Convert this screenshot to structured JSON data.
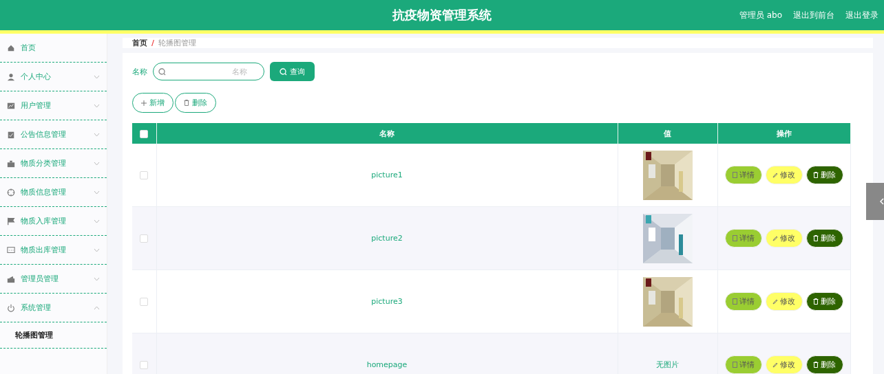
{
  "header": {
    "title": "抗疫物资管理系统",
    "links": [
      "管理员 abo",
      "退出到前台",
      "退出登录"
    ]
  },
  "sidebar": {
    "items": [
      {
        "label": "首页",
        "expandable": false
      },
      {
        "label": "个人中心",
        "expandable": true,
        "expanded": false
      },
      {
        "label": "用户管理",
        "expandable": true,
        "expanded": false
      },
      {
        "label": "公告信息管理",
        "expandable": true,
        "expanded": false
      },
      {
        "label": "物质分类管理",
        "expandable": true,
        "expanded": false
      },
      {
        "label": "物质信息管理",
        "expandable": true,
        "expanded": false
      },
      {
        "label": "物质入库管理",
        "expandable": true,
        "expanded": false
      },
      {
        "label": "物质出库管理",
        "expandable": true,
        "expanded": false
      },
      {
        "label": "管理员管理",
        "expandable": true,
        "expanded": false
      },
      {
        "label": "系统管理",
        "expandable": true,
        "expanded": true,
        "children": [
          {
            "label": "轮播图管理",
            "selected": true
          }
        ]
      }
    ]
  },
  "breadcrumb": {
    "items": [
      "首页",
      "轮播图管理"
    ],
    "separator": "/"
  },
  "search": {
    "label": "名称",
    "placeholder": "名称",
    "button": "查询"
  },
  "toolbar": {
    "add": "新增",
    "delete": "删除"
  },
  "table": {
    "header_checked": false,
    "columns": [
      "名称",
      "值",
      "操作"
    ],
    "rows": [
      {
        "checked": false,
        "name": "picture1",
        "value": {
          "kind": "picture"
        },
        "actions": [
          {
            "kind": "detail",
            "label": "详情"
          },
          {
            "kind": "edit",
            "label": "修改"
          },
          {
            "kind": "delete",
            "label": "删除"
          }
        ]
      },
      {
        "checked": false,
        "name": "picture2",
        "value": {
          "kind": "picture"
        },
        "actions": [
          {
            "kind": "detail",
            "label": "详情"
          },
          {
            "kind": "edit",
            "label": "修改"
          },
          {
            "kind": "delete",
            "label": "删除"
          }
        ]
      },
      {
        "checked": false,
        "name": "picture3",
        "value": {
          "kind": "picture"
        },
        "actions": [
          {
            "kind": "detail",
            "label": "详情"
          },
          {
            "kind": "edit",
            "label": "修改"
          },
          {
            "kind": "delete",
            "label": "删除"
          }
        ]
      },
      {
        "checked": false,
        "name": "homepage",
        "value": {
          "kind": "text",
          "text": "无图片"
        },
        "actions": [
          {
            "kind": "detail",
            "label": "详情"
          },
          {
            "kind": "edit",
            "label": "修改"
          },
          {
            "kind": "delete",
            "label": "删除"
          }
        ]
      }
    ]
  }
}
